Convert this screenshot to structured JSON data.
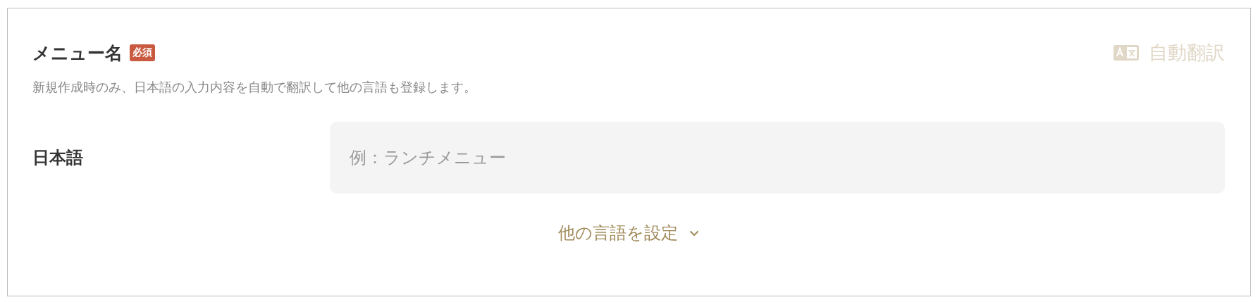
{
  "field": {
    "label": "メニュー名",
    "badge": "必須",
    "auto_translate": {
      "label": "自動翻訳",
      "disabled": true
    },
    "description": "新規作成時のみ、日本語の入力内容を自動で翻訳して他の言語も登録します。"
  },
  "languages": [
    {
      "label": "日本語",
      "placeholder": "例：ランチメニュー"
    }
  ],
  "more_languages": {
    "label": "他の言語を設定",
    "expanded": false
  }
}
